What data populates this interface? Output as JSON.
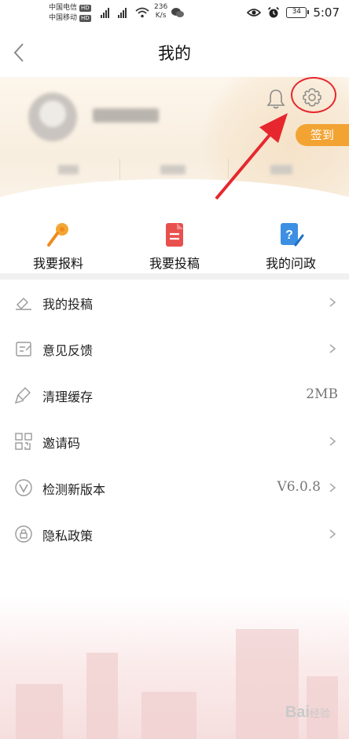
{
  "status_bar": {
    "carrier_1": "中国电信",
    "carrier_2": "中国移动",
    "hd_badge": "HD",
    "net_speed_value": "236",
    "net_speed_unit": "K/s",
    "battery": "34",
    "time": "5:07"
  },
  "header": {
    "title": "我的",
    "back_icon": "chevron-left-icon"
  },
  "profile": {
    "sign_in_label": "签到",
    "icons": [
      "bell-icon",
      "gear-icon"
    ],
    "annotation_color": "#e6272e",
    "sign_in_color": "#f2a332"
  },
  "quick_actions": [
    {
      "label": "我要报料",
      "icon": "microphone-icon",
      "color": "#f08a1c"
    },
    {
      "label": "我要投稿",
      "icon": "document-icon",
      "color": "#e8504e"
    },
    {
      "label": "我的问政",
      "icon": "question-pen-icon",
      "color": "#3d8fe3"
    }
  ],
  "menu": [
    {
      "label": "我的投稿",
      "icon": "submission-icon",
      "value": ""
    },
    {
      "label": "意见反馈",
      "icon": "feedback-icon",
      "value": ""
    },
    {
      "label": "清理缓存",
      "icon": "brush-icon",
      "value": "2MB"
    },
    {
      "label": "邀请码",
      "icon": "qrcode-icon",
      "value": ""
    },
    {
      "label": "检测新版本",
      "icon": "version-icon",
      "value": "V6.0.8"
    },
    {
      "label": "隐私政策",
      "icon": "privacy-icon",
      "value": ""
    }
  ],
  "watermark": {
    "brand": "Bai",
    "suffix": "经验"
  }
}
